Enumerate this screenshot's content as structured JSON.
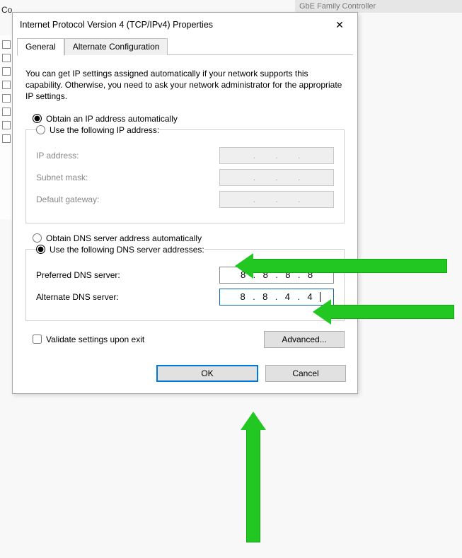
{
  "background": {
    "right_header_fragment": "GbE Family Controller",
    "left_label_fragment": "Co"
  },
  "dialog": {
    "title": "Internet Protocol Version 4 (TCP/IPv4) Properties",
    "tabs": {
      "general": "General",
      "alternate": "Alternate Configuration"
    },
    "description": "You can get IP settings assigned automatically if your network supports this capability. Otherwise, you need to ask your network administrator for the appropriate IP settings.",
    "ip": {
      "auto_label": "Obtain an IP address automatically",
      "manual_label": "Use the following IP address:",
      "selected": "auto",
      "fields": {
        "ip_address": {
          "label": "IP address:",
          "octets": [
            "",
            "",
            "",
            ""
          ]
        },
        "subnet": {
          "label": "Subnet mask:",
          "octets": [
            "",
            "",
            "",
            ""
          ]
        },
        "gateway": {
          "label": "Default gateway:",
          "octets": [
            "",
            "",
            "",
            ""
          ]
        }
      }
    },
    "dns": {
      "auto_label": "Obtain DNS server address automatically",
      "manual_label": "Use the following DNS server addresses:",
      "selected": "manual",
      "fields": {
        "preferred": {
          "label": "Preferred DNS server:",
          "octets": [
            "8",
            "8",
            "8",
            "8"
          ]
        },
        "alternate": {
          "label": "Alternate DNS server:",
          "octets": [
            "8",
            "8",
            "4",
            "4"
          ]
        }
      }
    },
    "validate_label": "Validate settings upon exit",
    "validate_checked": false,
    "advanced_label": "Advanced...",
    "ok_label": "OK",
    "cancel_label": "Cancel"
  },
  "annotations": {
    "color": "#22c722",
    "arrows": [
      {
        "target": "dns-manual-radio",
        "direction": "left"
      },
      {
        "target": "alternate-dns-input",
        "direction": "left"
      },
      {
        "target": "ok-button",
        "direction": "up"
      }
    ]
  }
}
